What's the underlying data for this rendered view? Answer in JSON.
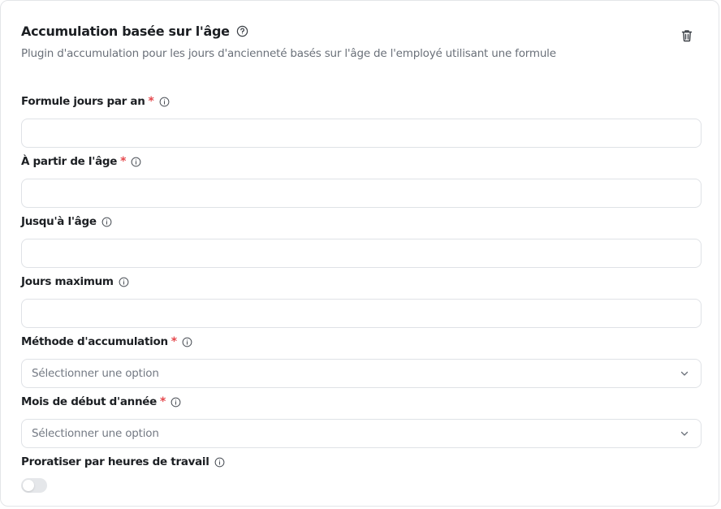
{
  "header": {
    "title": "Accumulation basée sur l'âge",
    "subtitle": "Plugin d'accumulation pour les jours d'ancienneté basés sur l'âge de l'employé utilisant une formule",
    "help_icon": "question-circle-icon",
    "delete_icon": "trash-icon"
  },
  "fields": {
    "formula": {
      "label": "Formule jours par an",
      "required_mark": "*",
      "value": ""
    },
    "from_age": {
      "label": "À partir de l'âge",
      "required_mark": "*",
      "value": ""
    },
    "to_age": {
      "label": "Jusqu'à l'âge",
      "value": ""
    },
    "max_days": {
      "label": "Jours maximum",
      "value": ""
    },
    "method": {
      "label": "Méthode d'accumulation",
      "required_mark": "*",
      "selected": "Sélectionner une option"
    },
    "start_month": {
      "label": "Mois de début d'année",
      "required_mark": "*",
      "selected": "Sélectionner une option"
    },
    "prorate": {
      "label": "Proratiser par heures de travail",
      "enabled": false
    }
  },
  "colors": {
    "required": "#e5484d",
    "border": "#dfe2e6",
    "toggle_off": "#e5e7ea"
  }
}
